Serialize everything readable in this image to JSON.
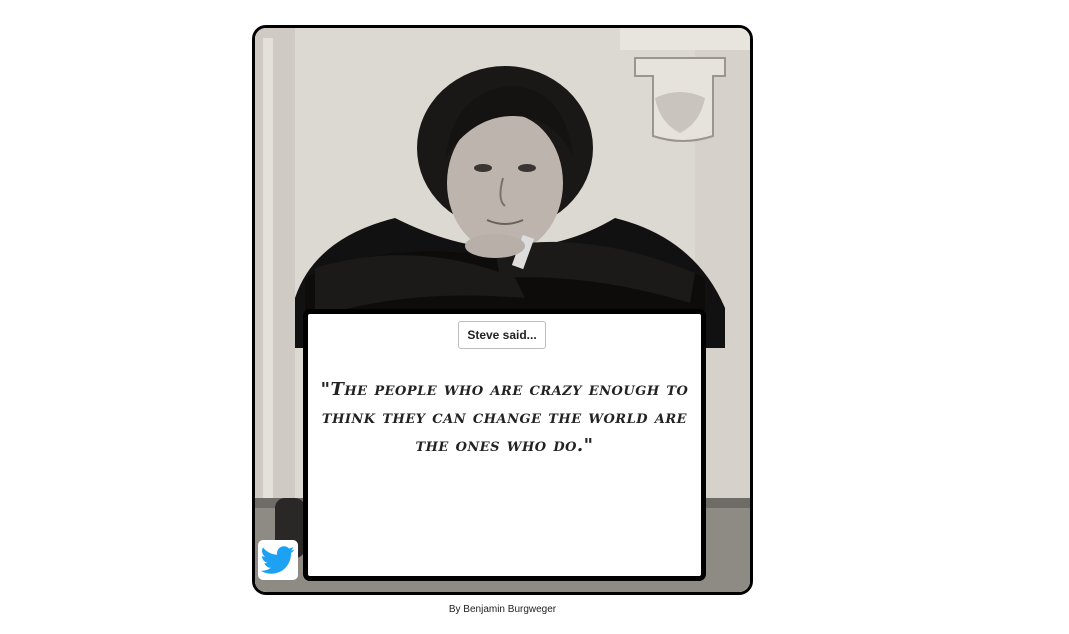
{
  "card": {
    "photo_alt": "Steve Jobs portrait",
    "button_label": "Steve said...",
    "quote": "\"The people who are crazy enough to think they can change the world are the ones who do.\"",
    "twitter_icon": "twitter-bird-icon"
  },
  "footer": {
    "apple_icon": "",
    "credit": "By Benjamin Burgweger"
  },
  "colors": {
    "border": "#000000",
    "twitter_blue": "#1da1f2",
    "background": "#ffffff"
  }
}
